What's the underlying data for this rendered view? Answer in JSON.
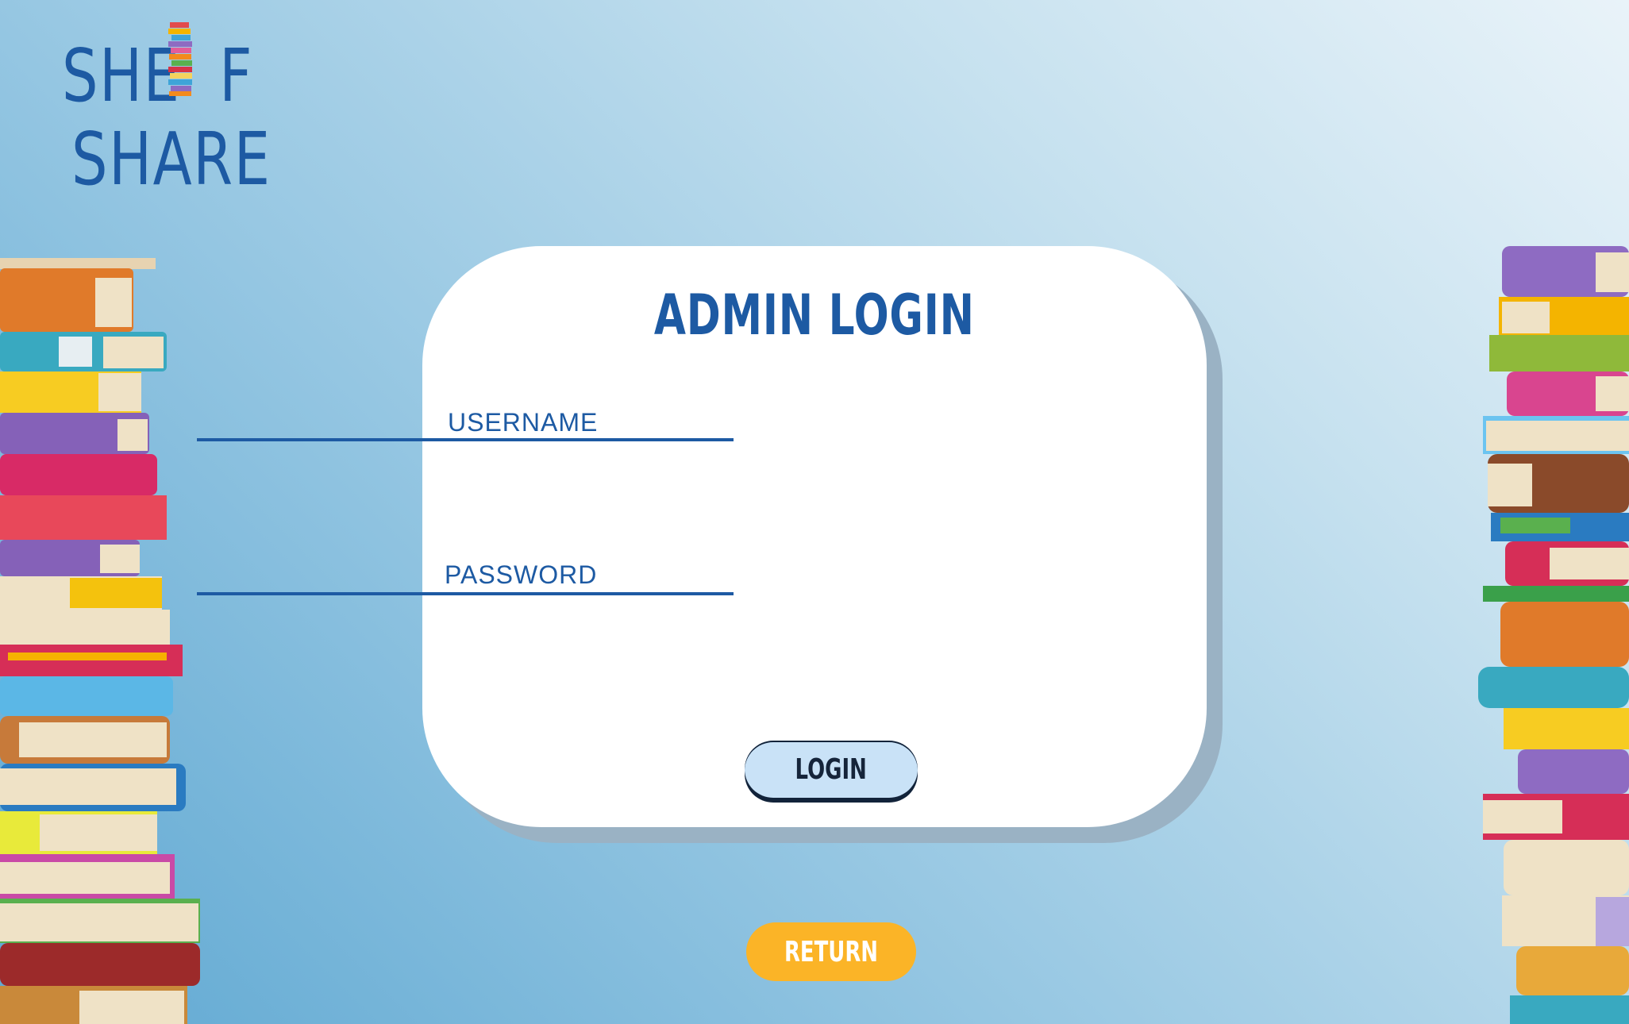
{
  "logo": {
    "line1": "SHE  F",
    "line2": "SHARE",
    "icon": "book-stack-icon"
  },
  "login_card": {
    "title": "ADMIN LOGIN",
    "username_label": "USERNAME",
    "username_value": "",
    "password_label": "PASSWORD",
    "password_value": "",
    "login_label": "LOGIN"
  },
  "return_label": "RETURN",
  "colors": {
    "brand_blue": "#1d5aa3",
    "login_button": "#c9e2f7",
    "return_button": "#fbb427",
    "card": "#ffffff"
  },
  "decor": {
    "left": "book-stack-left",
    "right": "book-stack-right"
  }
}
